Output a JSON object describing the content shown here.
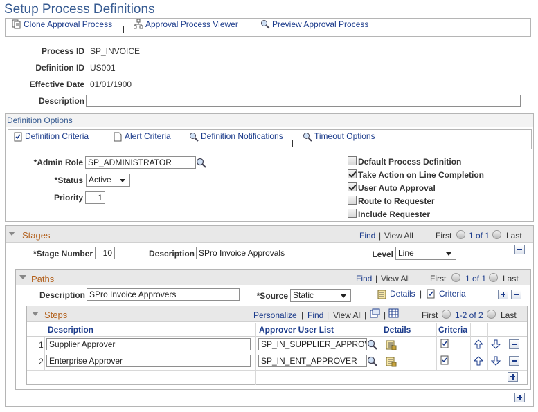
{
  "page": {
    "title": "Setup Process Definitions"
  },
  "toolbar": {
    "clone": "Clone Approval Process",
    "viewer": "Approval Process Viewer",
    "preview": "Preview Approval Process"
  },
  "header": {
    "process_id_label": "Process ID",
    "process_id": "SP_INVOICE",
    "definition_id_label": "Definition ID",
    "definition_id": "US001",
    "effective_date_label": "Effective Date",
    "effective_date": "01/01/1900",
    "description_label": "Description",
    "description": ""
  },
  "definition_options": {
    "title": "Definition Options",
    "tabs": [
      "Definition Criteria",
      "Alert Criteria",
      "Definition Notifications",
      "Timeout Options"
    ],
    "admin_role_label": "*Admin Role",
    "admin_role": "SP_ADMINISTRATOR",
    "status_label": "*Status",
    "status": "Active",
    "priority_label": "Priority",
    "priority": "1",
    "checkboxes": [
      {
        "label": "Default Process Definition",
        "checked": false
      },
      {
        "label": "Take Action on Line Completion",
        "checked": true
      },
      {
        "label": "User Auto Approval",
        "checked": true
      },
      {
        "label": "Route to Requester",
        "checked": false
      },
      {
        "label": "Include Requester",
        "checked": false
      }
    ]
  },
  "stages": {
    "title": "Stages",
    "find": "Find",
    "view_all": "View All",
    "first": "First",
    "pager": "1 of 1",
    "last": "Last",
    "stage_number_label": "*Stage Number",
    "stage_number": "10",
    "description_label": "Description",
    "description": "SPro Invoice Approvals",
    "level_label": "Level",
    "level": "Line"
  },
  "paths": {
    "title": "Paths",
    "find": "Find",
    "view_all": "View All",
    "first": "First",
    "pager": "1 of 1",
    "last": "Last",
    "description_label": "Description",
    "description": "SPro Invoice Approvers",
    "source_label": "*Source",
    "source": "Static",
    "details": "Details",
    "criteria": "Criteria"
  },
  "steps": {
    "title": "Steps",
    "personalize": "Personalize",
    "find": "Find",
    "view_all": "View All",
    "first": "First",
    "pager": "1-2 of 2",
    "last": "Last",
    "columns": [
      "Description",
      "Approver User List",
      "Details",
      "Criteria"
    ],
    "rows": [
      {
        "num": "1",
        "description": "Supplier Approver",
        "user_list": "SP_IN_SUPPLIER_APPROVER"
      },
      {
        "num": "2",
        "description": "Enterprise Approver",
        "user_list": "SP_IN_ENT_APPROVER"
      }
    ]
  },
  "colors": {
    "title": "#375b91",
    "link": "#1b3b8b",
    "section": "#b25f1a"
  }
}
